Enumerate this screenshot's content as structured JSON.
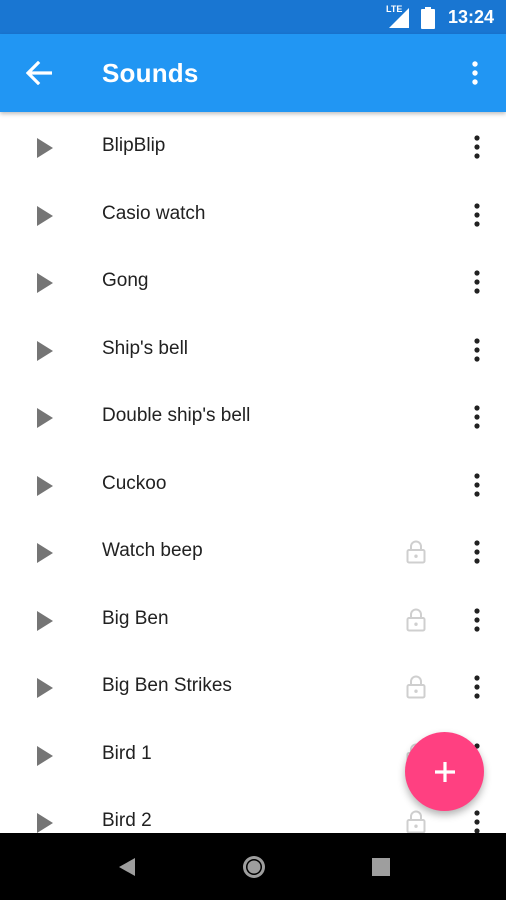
{
  "status_bar": {
    "network": "LTE",
    "time": "13:24"
  },
  "app_bar": {
    "title": "Sounds",
    "back_icon": "arrow-back-icon",
    "overflow_icon": "more-vert-icon"
  },
  "sounds": [
    {
      "name": "BlipBlip",
      "locked": false
    },
    {
      "name": "Casio watch",
      "locked": false
    },
    {
      "name": "Gong",
      "locked": false
    },
    {
      "name": "Ship's bell",
      "locked": false
    },
    {
      "name": "Double ship's bell",
      "locked": false
    },
    {
      "name": "Cuckoo",
      "locked": false
    },
    {
      "name": "Watch beep",
      "locked": true
    },
    {
      "name": "Big Ben",
      "locked": true
    },
    {
      "name": "Big Ben Strikes",
      "locked": true
    },
    {
      "name": "Bird 1",
      "locked": true
    },
    {
      "name": "Bird 2",
      "locked": true
    }
  ],
  "fab": {
    "icon": "add-icon",
    "color": "#ff4081"
  },
  "colors": {
    "primary": "#2196f3",
    "primary_dark": "#1976d2",
    "accent": "#ff4081"
  }
}
